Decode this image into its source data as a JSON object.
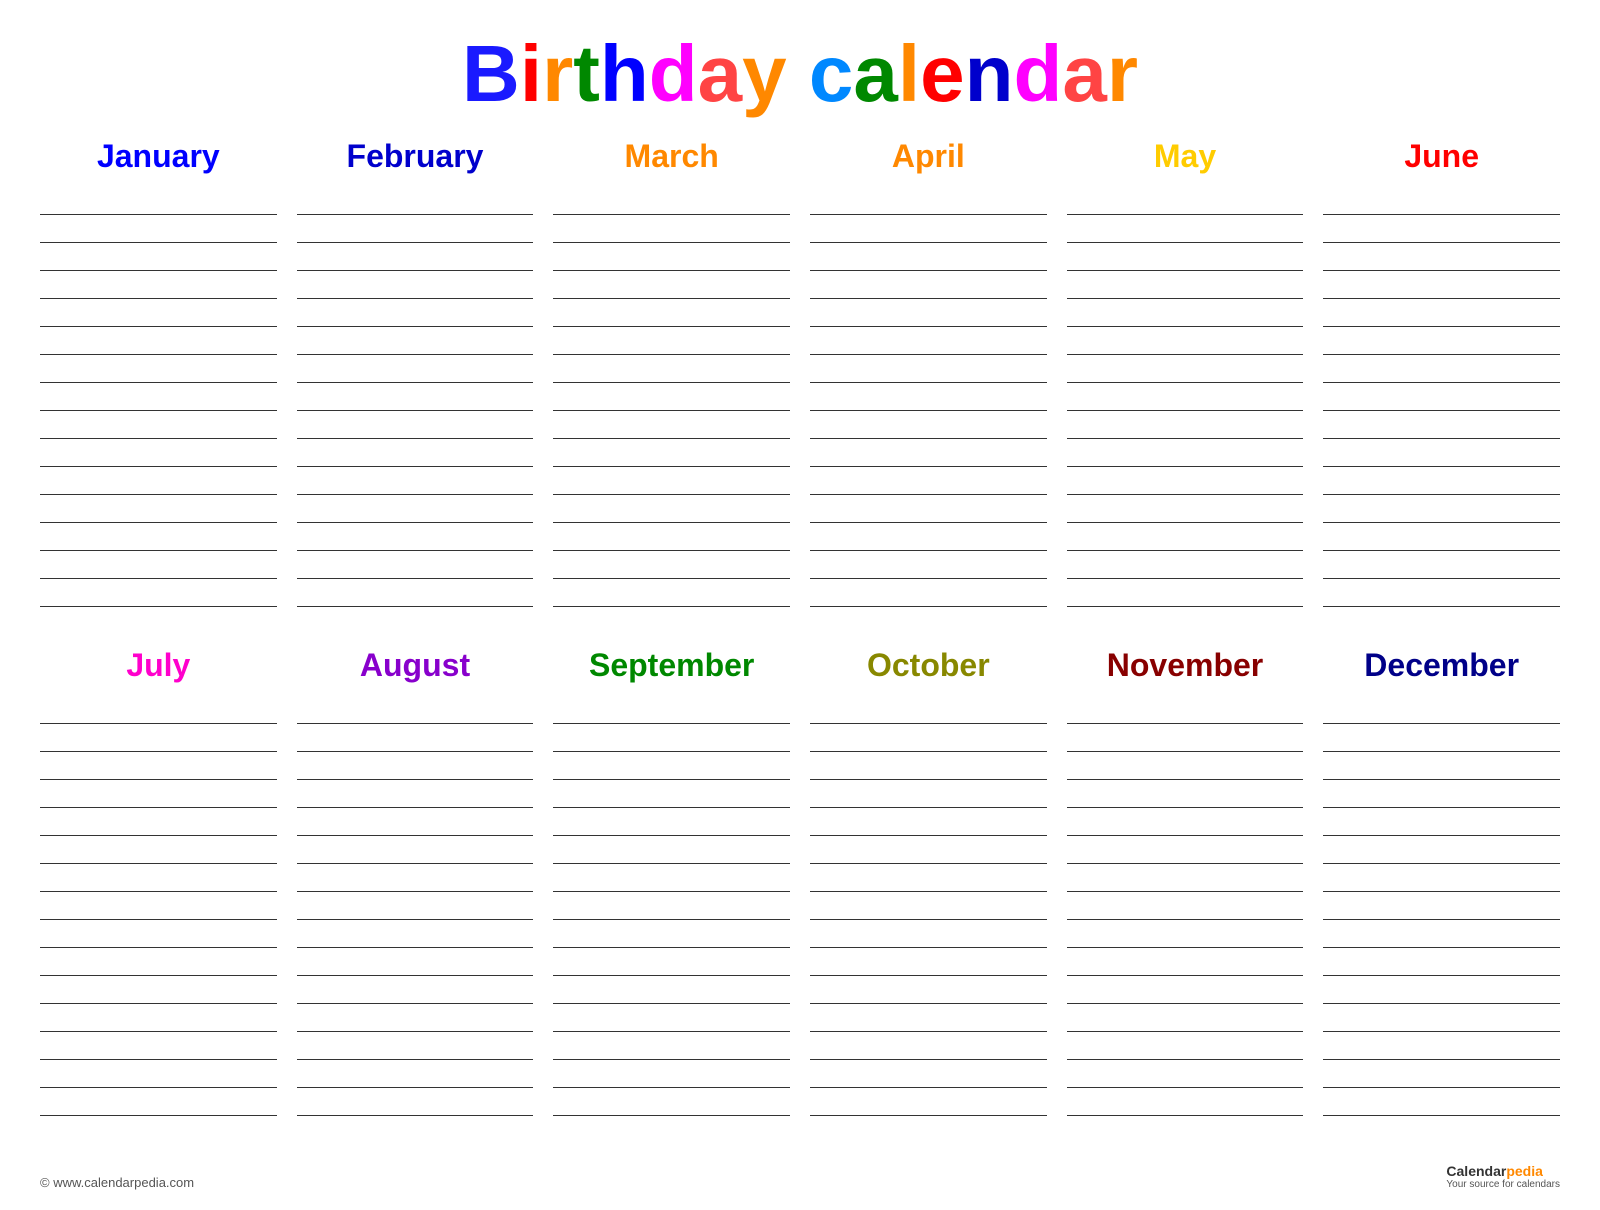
{
  "title": {
    "text": "Birthday calendar",
    "letters": [
      {
        "char": "B",
        "color": "#1a1aff"
      },
      {
        "char": "i",
        "color": "#ff0000"
      },
      {
        "char": "r",
        "color": "#ff8800"
      },
      {
        "char": "t",
        "color": "#008800"
      },
      {
        "char": "h",
        "color": "#0000ff"
      },
      {
        "char": "d",
        "color": "#ff00aa"
      },
      {
        "char": "a",
        "color": "#ff4400"
      },
      {
        "char": "y",
        "color": "#ff8800"
      },
      {
        "char": " ",
        "color": "#000000"
      },
      {
        "char": "c",
        "color": "#0088ff"
      },
      {
        "char": "a",
        "color": "#008800"
      },
      {
        "char": "l",
        "color": "#ff8800"
      },
      {
        "char": "e",
        "color": "#ff0000"
      },
      {
        "char": "n",
        "color": "#0000cc"
      },
      {
        "char": "d",
        "color": "#ff00aa"
      },
      {
        "char": "a",
        "color": "#ff4400"
      },
      {
        "char": "r",
        "color": "#888800"
      }
    ]
  },
  "months": [
    {
      "name": "January",
      "colorClass": "january",
      "lines": 15
    },
    {
      "name": "February",
      "colorClass": "february",
      "lines": 15
    },
    {
      "name": "March",
      "colorClass": "march",
      "lines": 15
    },
    {
      "name": "April",
      "colorClass": "april",
      "lines": 15
    },
    {
      "name": "May",
      "colorClass": "may",
      "lines": 15
    },
    {
      "name": "June",
      "colorClass": "june",
      "lines": 15
    },
    {
      "name": "July",
      "colorClass": "july",
      "lines": 15
    },
    {
      "name": "August",
      "colorClass": "august",
      "lines": 15
    },
    {
      "name": "September",
      "colorClass": "september",
      "lines": 15
    },
    {
      "name": "October",
      "colorClass": "october",
      "lines": 15
    },
    {
      "name": "November",
      "colorClass": "november",
      "lines": 15
    },
    {
      "name": "December",
      "colorClass": "december",
      "lines": 15
    }
  ],
  "footer": {
    "copyright": "© www.calendarpedia.com",
    "brand": "Calendarpedia",
    "brand_bold": "Calendar",
    "brand_color": "pedia",
    "tagline": "Your source for calendars"
  }
}
